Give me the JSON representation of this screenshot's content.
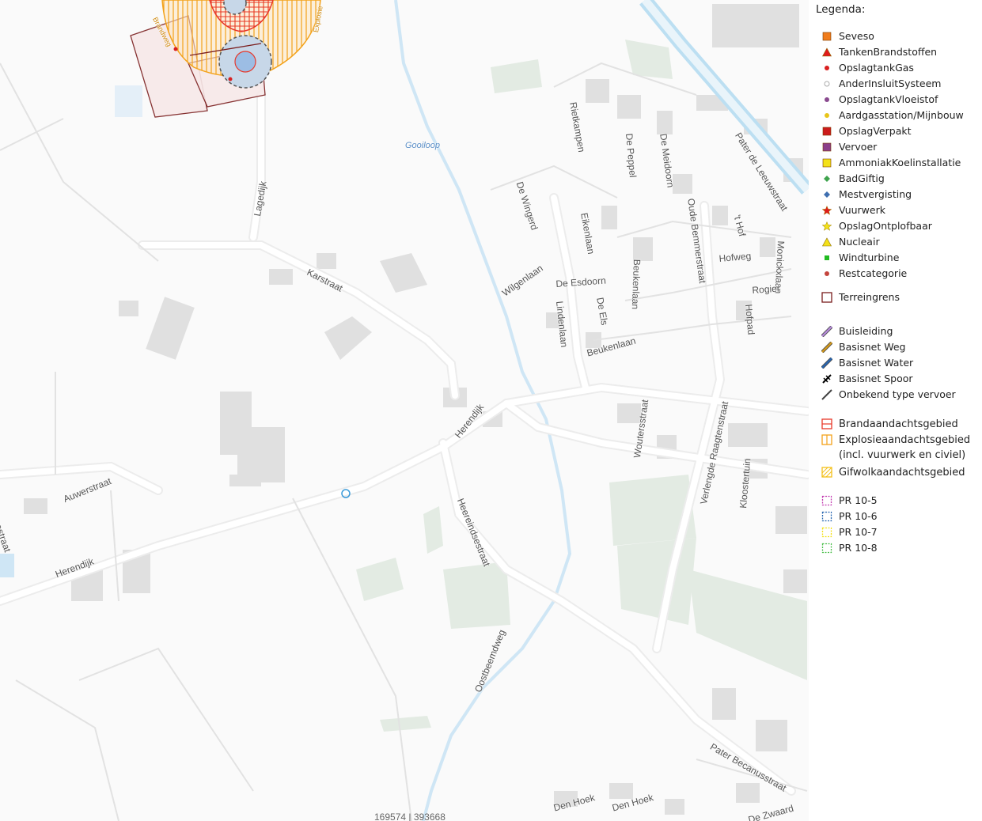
{
  "map": {
    "streets": [
      {
        "id": "lagedijk",
        "text": "Lagedijk"
      },
      {
        "id": "karstraat",
        "text": "Karstraat"
      },
      {
        "id": "herendijk1",
        "text": "Herendijk"
      },
      {
        "id": "herendijk2",
        "text": "Herendijk"
      },
      {
        "id": "auwerstraat",
        "text": "Auwerstraat"
      },
      {
        "id": "sestraat",
        "text": "sestraat"
      },
      {
        "id": "heereindsestraat",
        "text": "Heereindsestraat"
      },
      {
        "id": "oostbeemdweg",
        "text": "Oostbeemdweg"
      },
      {
        "id": "wilgenlaan",
        "text": "Wilgenlaan"
      },
      {
        "id": "dewingerd",
        "text": "De Wingerd"
      },
      {
        "id": "eikenlaan",
        "text": "Eikenlaan"
      },
      {
        "id": "deesdoorn",
        "text": "De Esdoorn"
      },
      {
        "id": "deels",
        "text": "De Els"
      },
      {
        "id": "lindenlaan",
        "text": "Lindenlaan"
      },
      {
        "id": "beukenlaan1",
        "text": "Beukenlaan"
      },
      {
        "id": "beukenlaan2",
        "text": "Beukenlaan"
      },
      {
        "id": "rietkampen",
        "text": "Rietkampen"
      },
      {
        "id": "depeppel",
        "text": "De Peppel"
      },
      {
        "id": "demeidoorn",
        "text": "De Meidoorn"
      },
      {
        "id": "oudebemmerstraat",
        "text": "Oude Bemmerstraat"
      },
      {
        "id": "paterleeuw",
        "text": "Pater de Leeuwstraat"
      },
      {
        "id": "thof",
        "text": "'t Hof"
      },
      {
        "id": "hofweg",
        "text": "Hofweg"
      },
      {
        "id": "monickxlaan",
        "text": "Monickxlaan"
      },
      {
        "id": "rogier",
        "text": "Rogier"
      },
      {
        "id": "hofpad",
        "text": "Hofpad"
      },
      {
        "id": "woutersstraat",
        "text": "Woutersstraat"
      },
      {
        "id": "verlengde",
        "text": "Verlengde Raagtenstraat"
      },
      {
        "id": "kloostertuin",
        "text": "Kloostertuin"
      },
      {
        "id": "paterbecanus",
        "text": "Pater Becanusstraat"
      },
      {
        "id": "denhoek1",
        "text": "Den Hoek"
      },
      {
        "id": "denhoek2",
        "text": "Den Hoek"
      },
      {
        "id": "zwaard",
        "text": "De Zwaard"
      },
      {
        "id": "gooiloop",
        "text": "Gooiloop"
      },
      {
        "id": "ringlabel1",
        "text": "Brandweg"
      },
      {
        "id": "ringlabel2",
        "text": "Explosie"
      }
    ],
    "coords": "169574 | 393668"
  },
  "legend": {
    "title": "Legenda:",
    "items": [
      {
        "label": "Seveso",
        "symbol": "square",
        "color": "#f07c1c"
      },
      {
        "label": "TankenBrandstoffen",
        "symbol": "triangle",
        "color": "#e01b1b"
      },
      {
        "label": "OpslagtankGas",
        "symbol": "dot",
        "color": "#d92020"
      },
      {
        "label": "AnderInsluitSysteem",
        "symbol": "ring",
        "color": "#aaaaaa"
      },
      {
        "label": "OpslagtankVloeistof",
        "symbol": "dot",
        "color": "#8a4a8f"
      },
      {
        "label": "Aardgasstation/Mijnbouw",
        "symbol": "dot",
        "color": "#e8c51a"
      },
      {
        "label": "OpslagVerpakt",
        "symbol": "square",
        "color": "#cc1c1c"
      },
      {
        "label": "Vervoer",
        "symbol": "square",
        "color": "#8b3f8b"
      },
      {
        "label": "AmmoniakKoelinstallatie",
        "symbol": "square",
        "color": "#f3e11a"
      },
      {
        "label": "BadGiftig",
        "symbol": "diamond",
        "color": "#3fa34d"
      },
      {
        "label": "Mestvergisting",
        "symbol": "diamond",
        "color": "#3f6fb0"
      },
      {
        "label": "Vuurwerk",
        "symbol": "star",
        "color": "#e01b1b"
      },
      {
        "label": "OpslagOntplofbaar",
        "symbol": "star",
        "color": "#f3e11a"
      },
      {
        "label": "Nucleair",
        "symbol": "triangle",
        "color": "#f3e11a"
      },
      {
        "label": "Windturbine",
        "symbol": "square-small",
        "color": "#22bb22"
      },
      {
        "label": "Restcategorie",
        "symbol": "dot",
        "color": "#c4453d"
      }
    ],
    "terreingrens": {
      "label": "Terreingrens",
      "color": "#7a1d1d"
    },
    "lines": [
      {
        "label": "Buisleiding",
        "color": "#b58bd8"
      },
      {
        "label": "Basisnet Weg",
        "color": "#d49a1d"
      },
      {
        "label": "Basisnet Water",
        "color": "#2a67b0"
      },
      {
        "label": "Basisnet Spoor",
        "color": "#000000"
      },
      {
        "label": "Onbekend type vervoer",
        "color": "#444444"
      }
    ],
    "areas": [
      {
        "label": "Brandaandachtsgebied",
        "color": "#e8382a"
      },
      {
        "label": "Explosieaandachtsgebied",
        "sublabel": "(incl. vuurwerk en civiel)",
        "color": "#f3a21a"
      },
      {
        "label": "Gifwolkaandachtsgebied",
        "color": "#f3c01a"
      }
    ],
    "pr": [
      {
        "label": "PR 10-5",
        "color": "#c23ab0"
      },
      {
        "label": "PR 10-6",
        "color": "#2a67b0"
      },
      {
        "label": "PR 10-7",
        "color": "#f3e11a"
      },
      {
        "label": "PR 10-8",
        "color": "#4cbf4c"
      }
    ]
  }
}
